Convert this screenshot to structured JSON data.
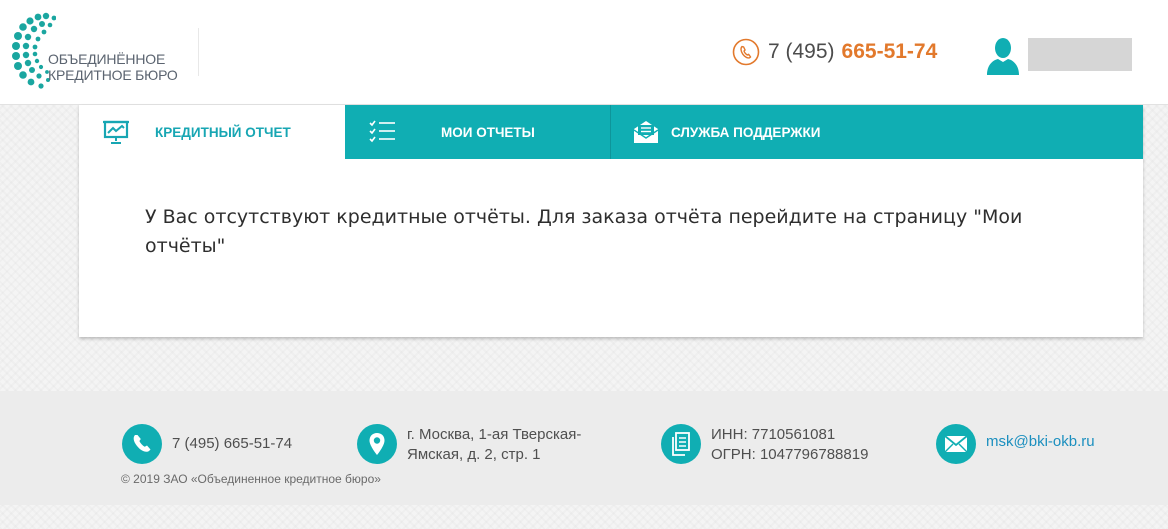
{
  "header": {
    "logo": {
      "line1": "ОБЪЕДИНЁННОЕ",
      "line2": "КРЕДИТНОЕ БЮРО"
    },
    "phone_prefix": "7 (495)",
    "phone_number": "665-51-74",
    "icons": {
      "phone": "phone-icon",
      "user": "user-icon"
    }
  },
  "tabs": [
    {
      "label": "КРЕДИТНЫЙ ОТЧЕТ",
      "icon": "chart-presentation-icon",
      "active": true
    },
    {
      "label": "МОИ ОТЧЕТЫ",
      "icon": "checklist-icon",
      "active": false
    },
    {
      "label": "СЛУЖБА ПОДДЕРЖКИ",
      "icon": "envelope-icon",
      "active": false
    }
  ],
  "main": {
    "message": "У Вас отсутствуют кредитные отчёты. Для заказа отчёта перейдите на страницу \"Мои отчёты\""
  },
  "footer": {
    "phone": "7 (495) 665-51-74",
    "address_line1": "г. Москва, 1-ая Тверская-",
    "address_line2": "Ямская, д. 2, стр. 1",
    "inn": "ИНН: 7710561081",
    "ogrn": "ОГРН: 1047796788819",
    "email": "msk@bki-okb.ru",
    "copyright": "© 2019 ЗАО «Объединенное кредитное бюро»"
  },
  "colors": {
    "teal": "#10aeb3",
    "orange": "#e2792c",
    "logo_dots": "#1aa6a0",
    "text": "#2e2e2e"
  }
}
